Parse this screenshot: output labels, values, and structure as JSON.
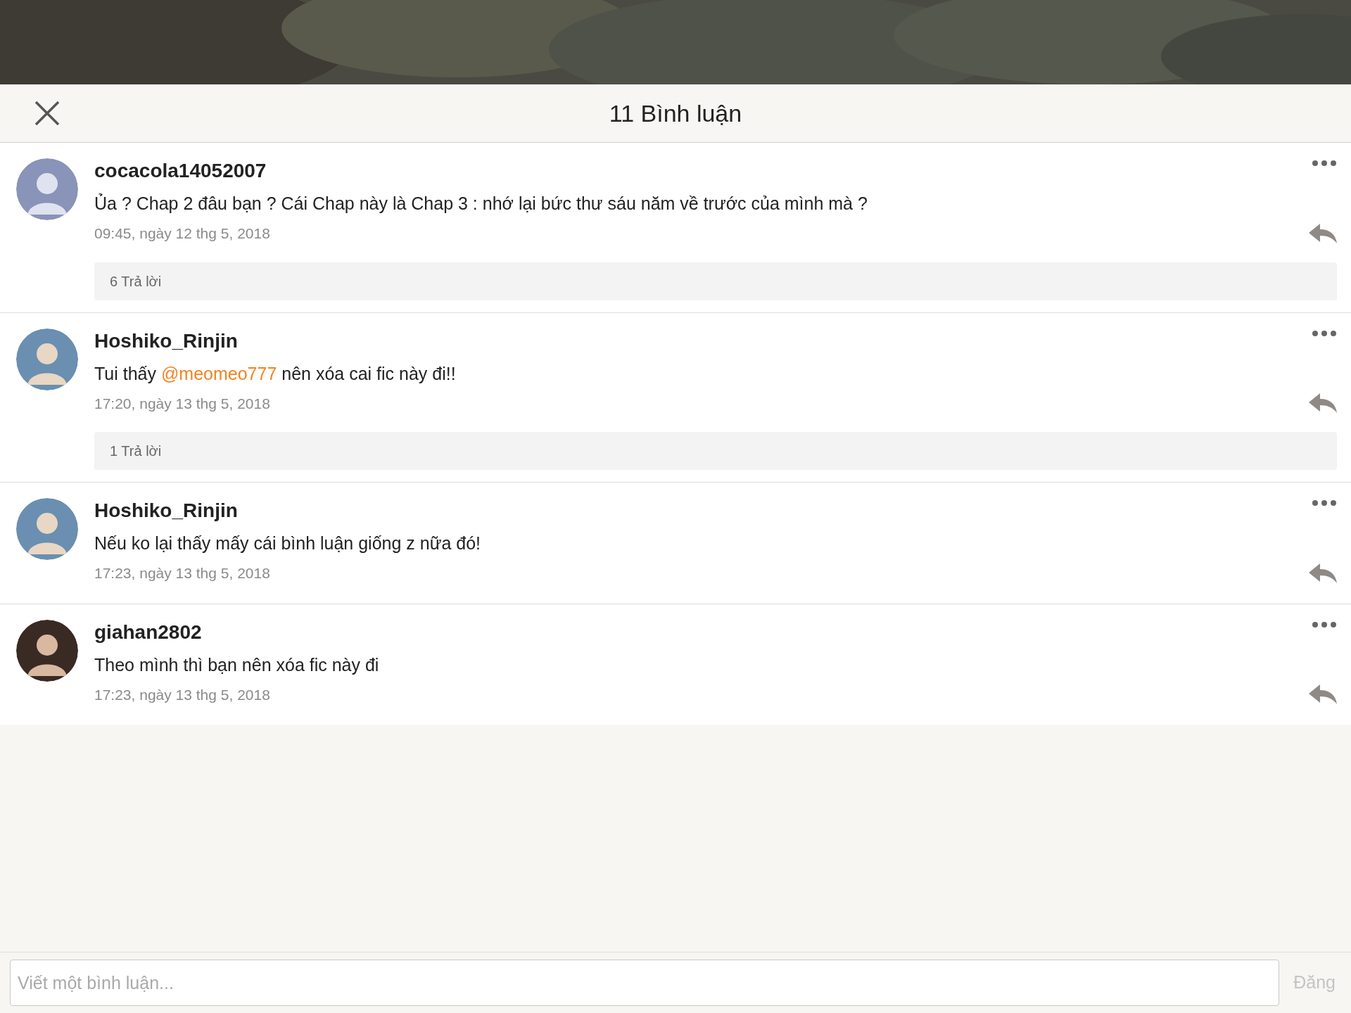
{
  "header": {
    "title": "11 Bình luận"
  },
  "comments": [
    {
      "username": "cocacola14052007",
      "text": [
        {
          "kind": "text",
          "text": "Ủa ? Chap 2 đâu bạn ? Cái Chap này là Chap 3 : nhớ lại bức thư sáu năm về trước của mình mà ?"
        }
      ],
      "time": "09:45, ngày 12 thg 5, 2018",
      "replies": "6 Trả lời"
    },
    {
      "username": "Hoshiko_Rinjin",
      "text": [
        {
          "kind": "text",
          "text": "Tui thấy "
        },
        {
          "kind": "mention",
          "text": "@meomeo777"
        },
        {
          "kind": "text",
          "text": " nên xóa cai fic này đi!!"
        }
      ],
      "time": "17:20, ngày 13 thg 5, 2018",
      "replies": "1 Trả lời"
    },
    {
      "username": "Hoshiko_Rinjin",
      "text": [
        {
          "kind": "text",
          "text": "Nếu ko lại thấy mấy cái bình luận giống z nữa đó!"
        }
      ],
      "time": "17:23, ngày 13 thg 5, 2018"
    },
    {
      "username": "giahan2802",
      "text": [
        {
          "kind": "text",
          "text": "Theo mình thì bạn nên xóa fic này đi"
        }
      ],
      "time": "17:23, ngày 13 thg 5, 2018"
    }
  ],
  "composer": {
    "placeholder": "Viết một bình luận...",
    "submit": "Đăng",
    "disabled": true
  }
}
